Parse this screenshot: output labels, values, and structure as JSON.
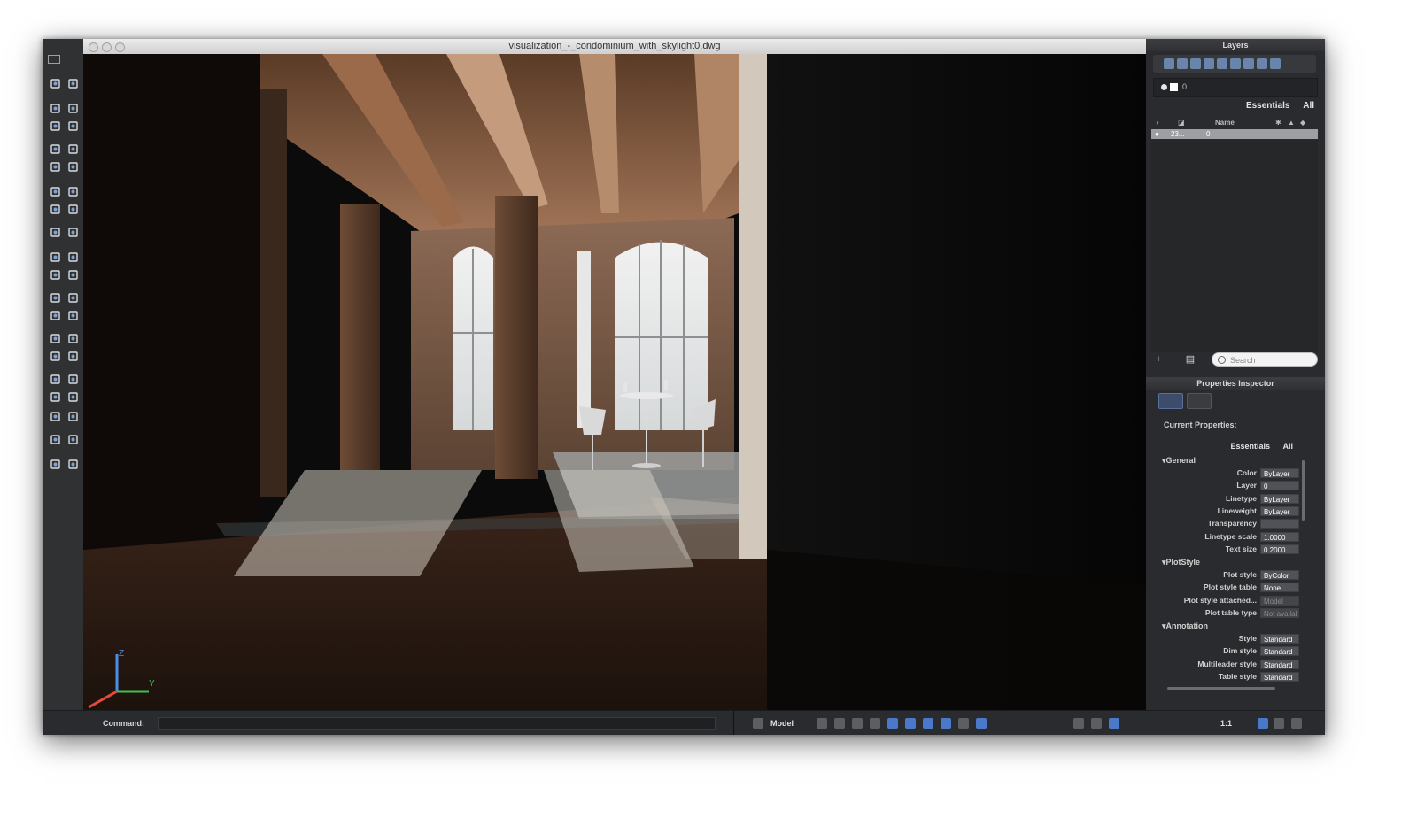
{
  "window": {
    "title": "visualization_-_condominium_with_skylight0.dwg"
  },
  "layers_panel": {
    "header": "Layers",
    "current_layer": "0",
    "tabs": [
      "Essentials",
      "All"
    ],
    "columns": {
      "name": "Name"
    },
    "rows": [
      {
        "id": "23...",
        "name": "0"
      }
    ],
    "search_placeholder": "Search"
  },
  "properties_inspector": {
    "header": "Properties Inspector",
    "current_properties_label": "Current Properties:",
    "tabs": [
      "Essentials",
      "All"
    ],
    "sections": {
      "general": {
        "label": "General",
        "rows": [
          {
            "label": "Color",
            "value": "ByLayer"
          },
          {
            "label": "Layer",
            "value": "0"
          },
          {
            "label": "Linetype",
            "value": "ByLayer"
          },
          {
            "label": "Lineweight",
            "value": "ByLayer"
          },
          {
            "label": "Transparency",
            "value": ""
          },
          {
            "label": "Linetype scale",
            "value": "1.0000"
          },
          {
            "label": "Text size",
            "value": "0.2000"
          }
        ]
      },
      "plotstyle": {
        "label": "PlotStyle",
        "rows": [
          {
            "label": "Plot style",
            "value": "ByColor"
          },
          {
            "label": "Plot style table",
            "value": "None"
          },
          {
            "label": "Plot style attached...",
            "value": "Model"
          },
          {
            "label": "Plot table type",
            "value": "Not availal"
          }
        ]
      },
      "annotation": {
        "label": "Annotation",
        "rows": [
          {
            "label": "Style",
            "value": "Standard"
          },
          {
            "label": "Dim style",
            "value": "Standard"
          },
          {
            "label": "Multileader style",
            "value": "Standard"
          },
          {
            "label": "Table style",
            "value": "Standard"
          }
        ]
      }
    }
  },
  "status_bar": {
    "command_label": "Command:",
    "model_label": "Model",
    "annotation_scale": "1:1"
  },
  "ucs": {
    "x": "X",
    "y": "Y",
    "z": "Z"
  },
  "colors": {
    "accent": "#4a79c9",
    "panel_bg": "#2a2b2e",
    "titlebar": "#dcdcdc"
  }
}
